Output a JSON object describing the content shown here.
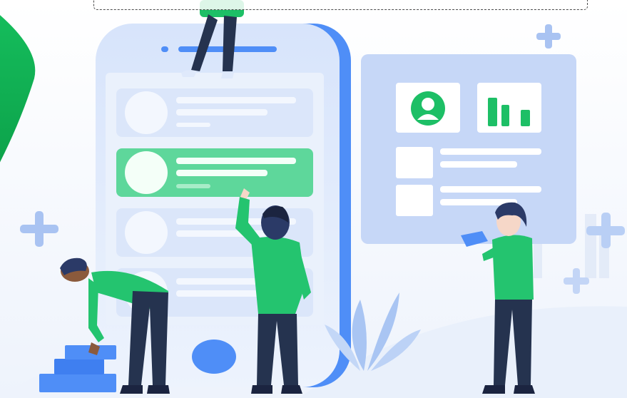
{
  "illustration": {
    "theme": "mobile app team collaboration",
    "colors": {
      "primary_blue": "#4f8ef7",
      "light_blue": "#dfe9fb",
      "panel_blue": "#c8d9f8",
      "accent_green": "#1dbf66",
      "bright_green": "#24c46f",
      "navy": "#25334f",
      "dark_navy": "#1b2440",
      "skin": "#f6d7c8",
      "dark_skin": "#8b5a3c"
    },
    "icons": {
      "profile": "user-avatar-icon",
      "chart": "bar-chart-icon",
      "plus": "plus-icon"
    }
  }
}
